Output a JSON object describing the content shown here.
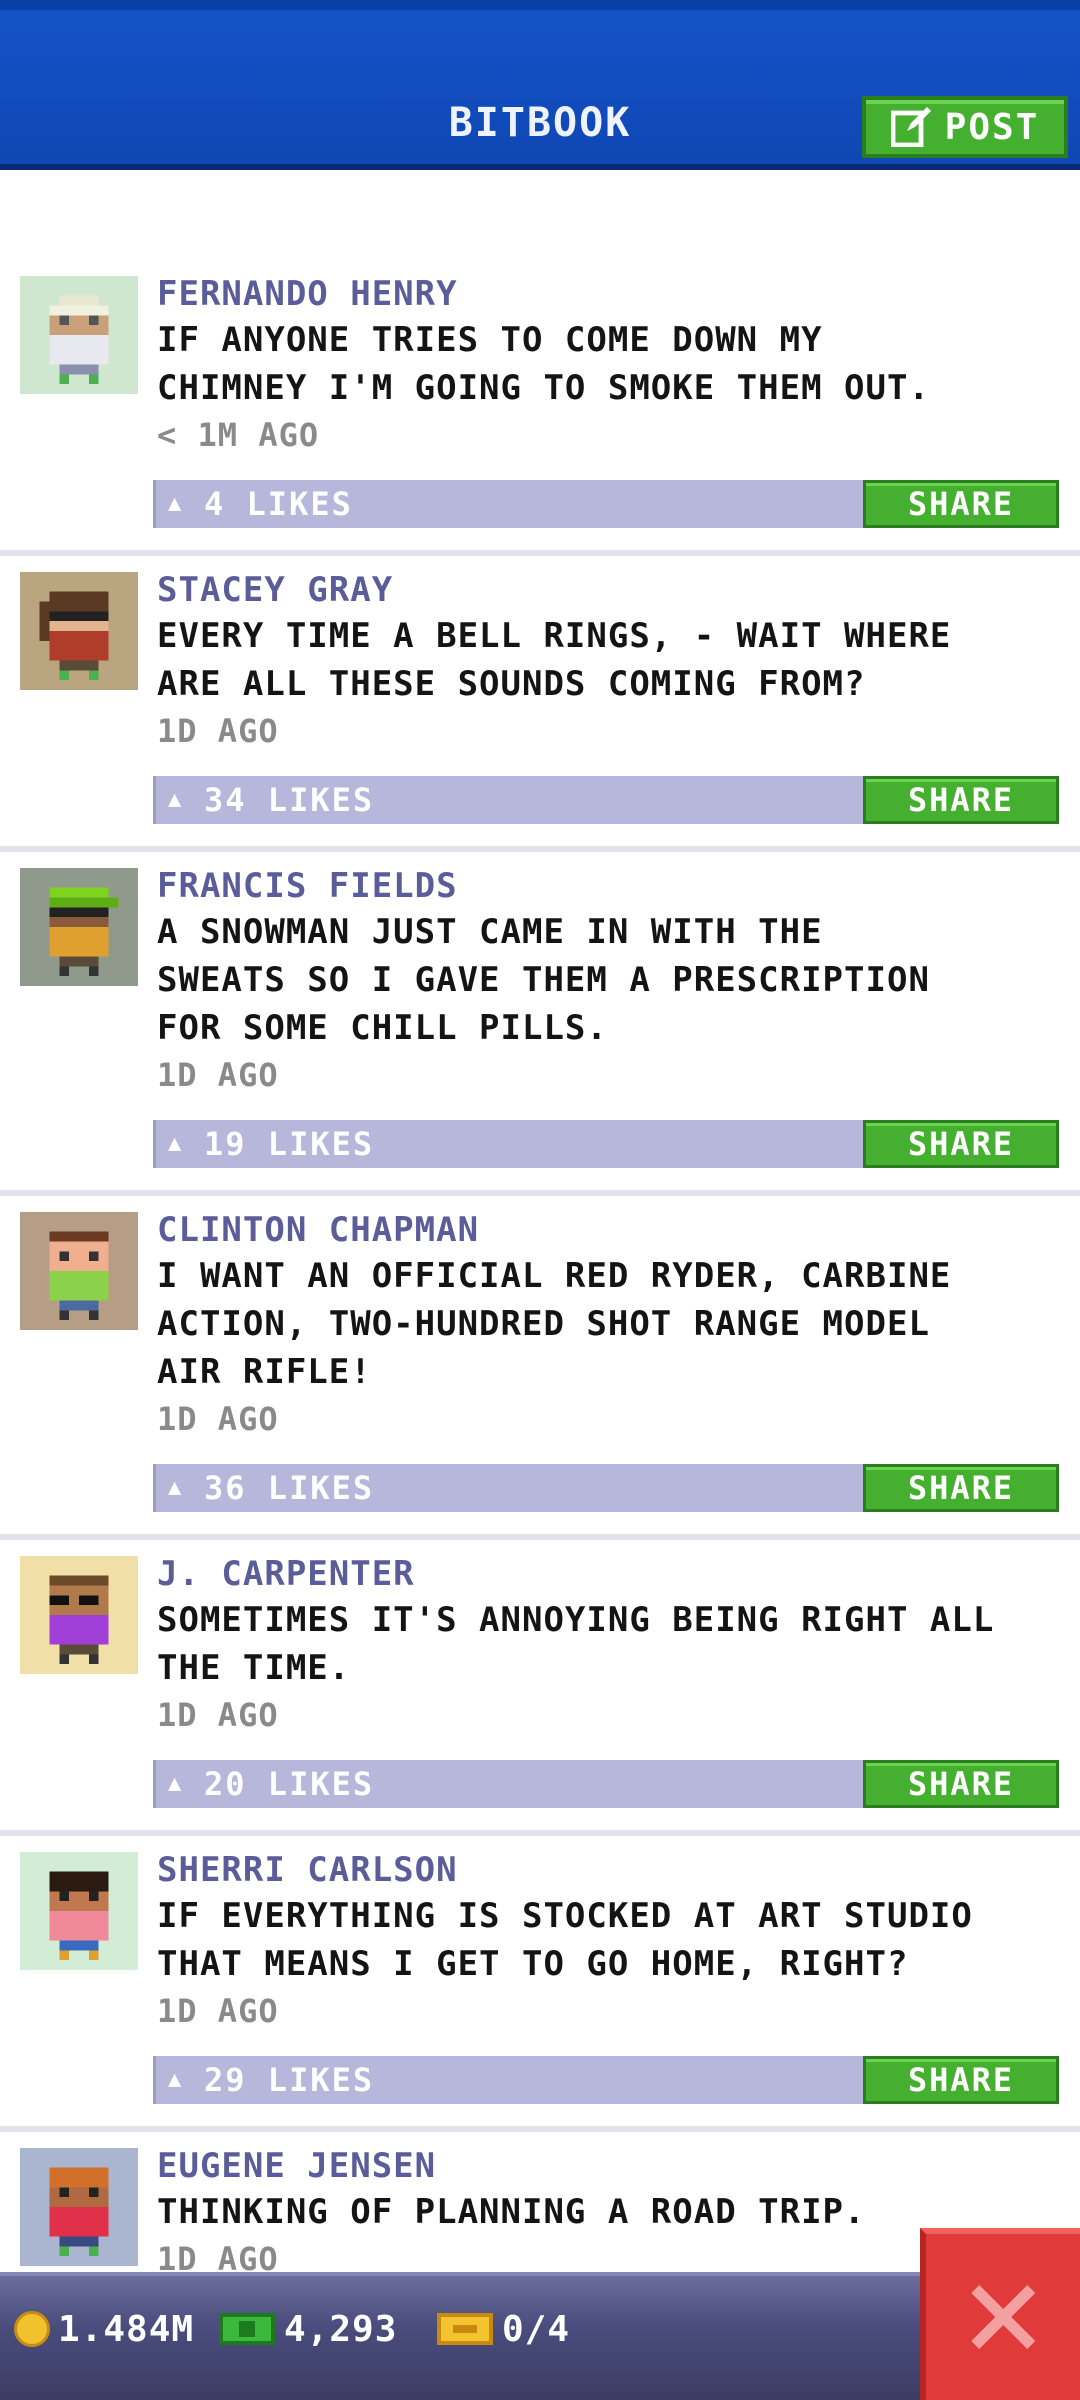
{
  "header": {
    "title": "BITBOOK",
    "post_label": "POST"
  },
  "posts": [
    {
      "name": "FERNANDO HENRY",
      "lines": [
        "IF ANYONE TRIES TO COME DOWN MY",
        "CHIMNEY I'M GOING TO SMOKE THEM OUT."
      ],
      "time": "< 1M AGO",
      "likes": "4 LIKES",
      "share_label": "SHARE",
      "avatar_bg": "#cfe7cf"
    },
    {
      "name": "STACEY GRAY",
      "lines": [
        "EVERY TIME A BELL RINGS, - WAIT WHERE",
        "ARE ALL THESE SOUNDS COMING FROM?"
      ],
      "time": "1D AGO",
      "likes": "34 LIKES",
      "share_label": "SHARE",
      "avatar_bg": "#b9a681"
    },
    {
      "name": "FRANCIS FIELDS",
      "lines": [
        "A SNOWMAN JUST CAME IN WITH THE",
        "SWEATS SO I GAVE THEM A PRESCRIPTION",
        "FOR SOME CHILL PILLS."
      ],
      "time": "1D AGO",
      "likes": "19 LIKES",
      "share_label": "SHARE",
      "avatar_bg": "#8f9a8c"
    },
    {
      "name": "CLINTON CHAPMAN",
      "lines": [
        "I WANT AN OFFICIAL RED RYDER, CARBINE",
        "ACTION, TWO-HUNDRED SHOT RANGE MODEL",
        "AIR RIFLE!"
      ],
      "time": "1D AGO",
      "likes": "36 LIKES",
      "share_label": "SHARE",
      "avatar_bg": "#b69d85"
    },
    {
      "name": "J. CARPENTER",
      "lines": [
        "SOMETIMES IT'S ANNOYING BEING RIGHT ALL",
        "THE TIME."
      ],
      "time": "1D AGO",
      "likes": "20 LIKES",
      "share_label": "SHARE",
      "avatar_bg": "#f0e0a8"
    },
    {
      "name": "SHERRI CARLSON",
      "lines": [
        "IF EVERYTHING IS STOCKED AT ART STUDIO",
        "THAT MEANS I GET TO GO HOME, RIGHT?"
      ],
      "time": "1D AGO",
      "likes": "29 LIKES",
      "share_label": "SHARE",
      "avatar_bg": "#d2ecd6"
    },
    {
      "name": "EUGENE JENSEN",
      "lines": [
        "THINKING OF PLANNING A ROAD TRIP."
      ],
      "time": "1D AGO",
      "likes": "",
      "share_label": "",
      "avatar_bg": "#aab6cf"
    }
  ],
  "bottom_bar": {
    "coins": "1.484M",
    "bux": "4,293",
    "tickets": "0/4"
  },
  "colors": {
    "header_blue": "#1553c9",
    "share_green": "#45b02f",
    "like_bar": "#b6b7db",
    "name_purple": "#5b5d9a",
    "close_red": "#e03a3a"
  }
}
